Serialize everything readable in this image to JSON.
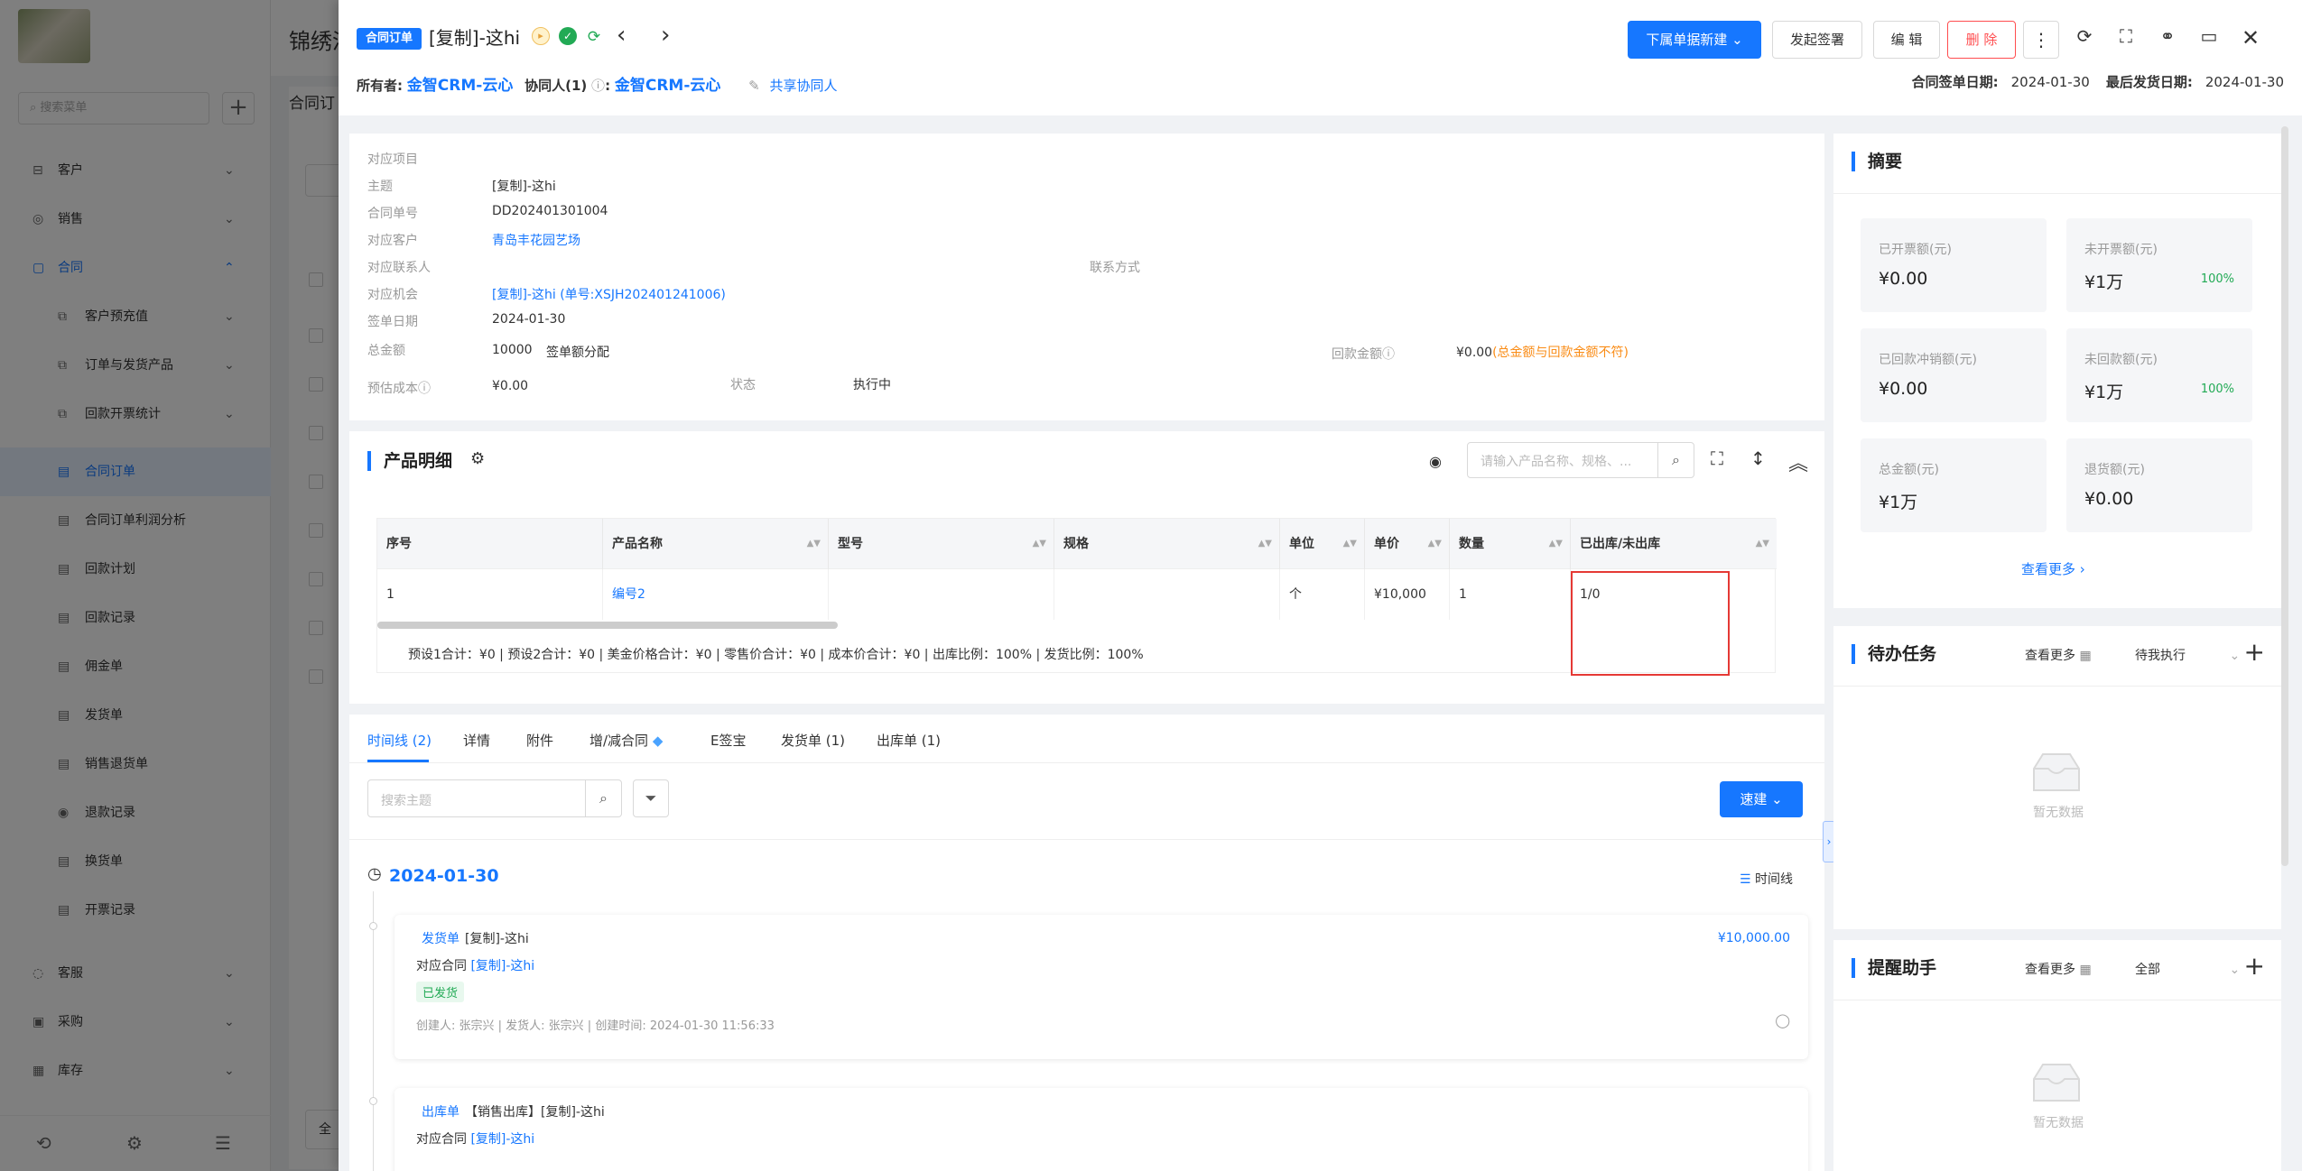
{
  "background": {
    "search_placeholder": "搜索菜单",
    "page_title": "锦绣洞",
    "list_tab": "合同订",
    "select_all": "全",
    "nav": [
      {
        "label": "客户",
        "icon": "customer-icon"
      },
      {
        "label": "销售",
        "icon": "sales-icon"
      },
      {
        "label": "合同",
        "icon": "contract-icon"
      },
      {
        "label": "客户预充值",
        "icon": "copy-icon"
      },
      {
        "label": "订单与发货产品",
        "icon": "copy-icon"
      },
      {
        "label": "回款开票统计",
        "icon": "copy-icon"
      },
      {
        "label": "合同订单",
        "icon": "doc-icon"
      },
      {
        "label": "合同订单利润分析",
        "icon": "doc-icon"
      },
      {
        "label": "回款计划",
        "icon": "doc-icon"
      },
      {
        "label": "回款记录",
        "icon": "doc-icon"
      },
      {
        "label": "佣金单",
        "icon": "doc-icon"
      },
      {
        "label": "发货单",
        "icon": "doc-icon"
      },
      {
        "label": "销售退货单",
        "icon": "doc-icon"
      },
      {
        "label": "退款记录",
        "icon": "doc-icon"
      },
      {
        "label": "换货单",
        "icon": "doc-icon"
      },
      {
        "label": "开票记录",
        "icon": "doc-icon"
      },
      {
        "label": "客服",
        "icon": "service-icon"
      },
      {
        "label": "采购",
        "icon": "purchase-icon"
      },
      {
        "label": "库存",
        "icon": "stock-icon"
      }
    ]
  },
  "header": {
    "tag": "合同订单",
    "title": "[复制]-这hi",
    "buttons": {
      "push_new": "下属单据新建",
      "sign": "发起签署",
      "edit": "编 辑",
      "delete": "删 除"
    },
    "owner_label": "所有者:",
    "owner_value": "金智CRM-云心",
    "collab_label": "协同人(1)",
    "collab_value": "金智CRM-云心",
    "share_label": "共享协同人",
    "sign_date_label": "合同签单日期:",
    "sign_date_value": "2024-01-30",
    "last_ship_label": "最后发货日期:",
    "last_ship_value": "2024-01-30"
  },
  "info": {
    "project_label": "对应项目",
    "subject_label": "主题",
    "subject_value": "[复制]-这hi",
    "order_no_label": "合同单号",
    "order_no_value": "DD202401301004",
    "customer_label": "对应客户",
    "customer_value": "青岛丰花园艺场",
    "contact_label": "对应联系人",
    "contact_method_label": "联系方式",
    "opportunity_label": "对应机会",
    "opportunity_value": "[复制]-这hi (单号:XSJH202401241006)",
    "sign_date_label": "签单日期",
    "sign_date_value": "2024-01-30",
    "total_label": "总金额",
    "total_value": "10000",
    "total_extra": "签单额分配",
    "payment_label": "回款金额",
    "payment_value": "¥0.00",
    "payment_warn": "(总金额与回款金额不符)",
    "cost_label": "预估成本",
    "cost_value": "¥0.00",
    "status_label": "状态",
    "status_value": "执行中"
  },
  "products": {
    "title": "产品明细",
    "search_placeholder": "请输入产品名称、规格、...",
    "columns": [
      "序号",
      "产品名称",
      "型号",
      "规格",
      "单位",
      "单价",
      "数量",
      "已出库/未出库"
    ],
    "rows": [
      {
        "index": "1",
        "name": "编号2",
        "model": "",
        "spec": "",
        "unit": "个",
        "price": "¥10,000",
        "qty": "1",
        "out": "1/0"
      }
    ],
    "summary": "预设1合计：¥0 |  预设2合计：¥0 |  美金价格合计：¥0 |  零售价合计：¥0 |  成本价合计：¥0 |  出库比例：100% |  发货比例：100%"
  },
  "timeline": {
    "tabs": [
      "时间线 (2)",
      "详情",
      "附件",
      "增/减合同",
      "E签宝",
      "发货单 (1)",
      "出库单 (1)"
    ],
    "search_placeholder": "搜索主题",
    "quick_label": "速建",
    "date": "2024-01-30",
    "view_label": "时间线",
    "cards": [
      {
        "type": "发货单",
        "title": "[复制]-这hi",
        "related_label": "对应合同",
        "related_value": "[复制]-这hi",
        "badge": "已发货",
        "meta": "创建人: 张宗兴  |  发货人: 张宗兴  |  创建时间: 2024-01-30 11:56:33",
        "amount": "¥10,000.00"
      },
      {
        "type": "出库单",
        "title": "【销售出库】[复制]-这hi",
        "related_label": "对应合同",
        "related_value": "[复制]-这hi"
      }
    ]
  },
  "summary_panel": {
    "title": "摘要",
    "stats": [
      {
        "label": "已开票额(元)",
        "value": "¥0.00",
        "pct": ""
      },
      {
        "label": "未开票额(元)",
        "value": "¥1万",
        "pct": "100%"
      },
      {
        "label": "已回款冲销额(元)",
        "value": "¥0.00",
        "pct": ""
      },
      {
        "label": "未回款额(元)",
        "value": "¥1万",
        "pct": "100%"
      },
      {
        "label": "总金额(元)",
        "value": "¥1万",
        "pct": ""
      },
      {
        "label": "退货额(元)",
        "value": "¥0.00",
        "pct": ""
      }
    ],
    "more": "查看更多"
  },
  "tasks_panel": {
    "title": "待办任务",
    "more": "查看更多",
    "filter": "待我执行",
    "empty": "暂无数据"
  },
  "reminder_panel": {
    "title": "提醒助手",
    "more": "查看更多",
    "filter": "全部",
    "empty": "暂无数据"
  },
  "colors": {
    "primary": "#1677ff",
    "danger": "#ff4d4f",
    "success": "#22aa55",
    "warning": "#fa8c16",
    "highlight": "#e53935"
  }
}
